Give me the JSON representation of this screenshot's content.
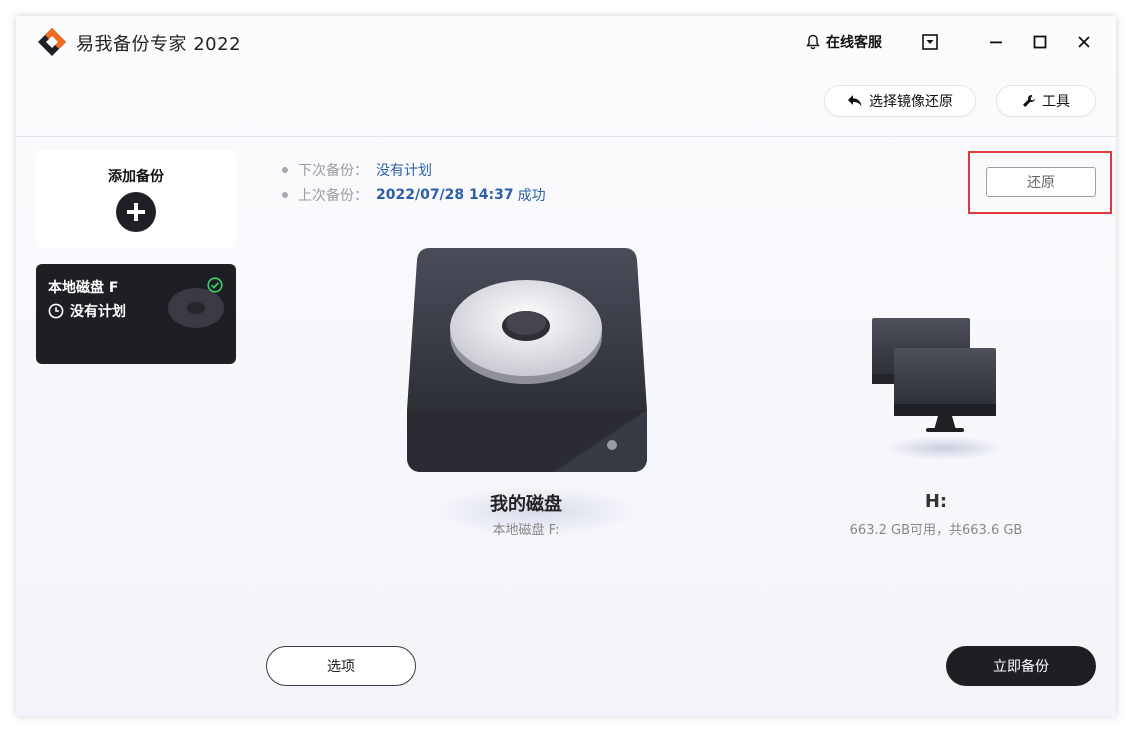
{
  "app": {
    "title": "易我备份专家 2022"
  },
  "titlebar": {
    "support_label": "在线客服",
    "support_icon": "bell-icon"
  },
  "toolbar": {
    "restore_image_label": "选择镜像还原",
    "restore_image_icon": "undo-arrow-icon",
    "tools_label": "工具",
    "tools_icon": "wrench-icon"
  },
  "sidebar": {
    "add_backup_label": "添加备份",
    "backup_item": {
      "title": "本地磁盘 F",
      "schedule": "没有计划"
    }
  },
  "info": {
    "next_backup_label": "下次备份：",
    "next_backup_value": "没有计划",
    "last_backup_label": "上次备份：",
    "last_backup_value": "2022/07/28 14:37",
    "last_backup_status": "成功"
  },
  "restore_button": "还原",
  "source": {
    "name": "我的磁盘",
    "sub": "本地磁盘 F:"
  },
  "destination": {
    "name": "H:",
    "sub": "663.2 GB可用，共663.6 GB"
  },
  "buttons": {
    "options": "选项",
    "backup_now": "立即备份"
  },
  "colors": {
    "accent_dark": "#1e1f24",
    "link_blue": "#2b5fa8",
    "highlight_red": "#e0393e",
    "success_green": "#3ecf6a"
  }
}
